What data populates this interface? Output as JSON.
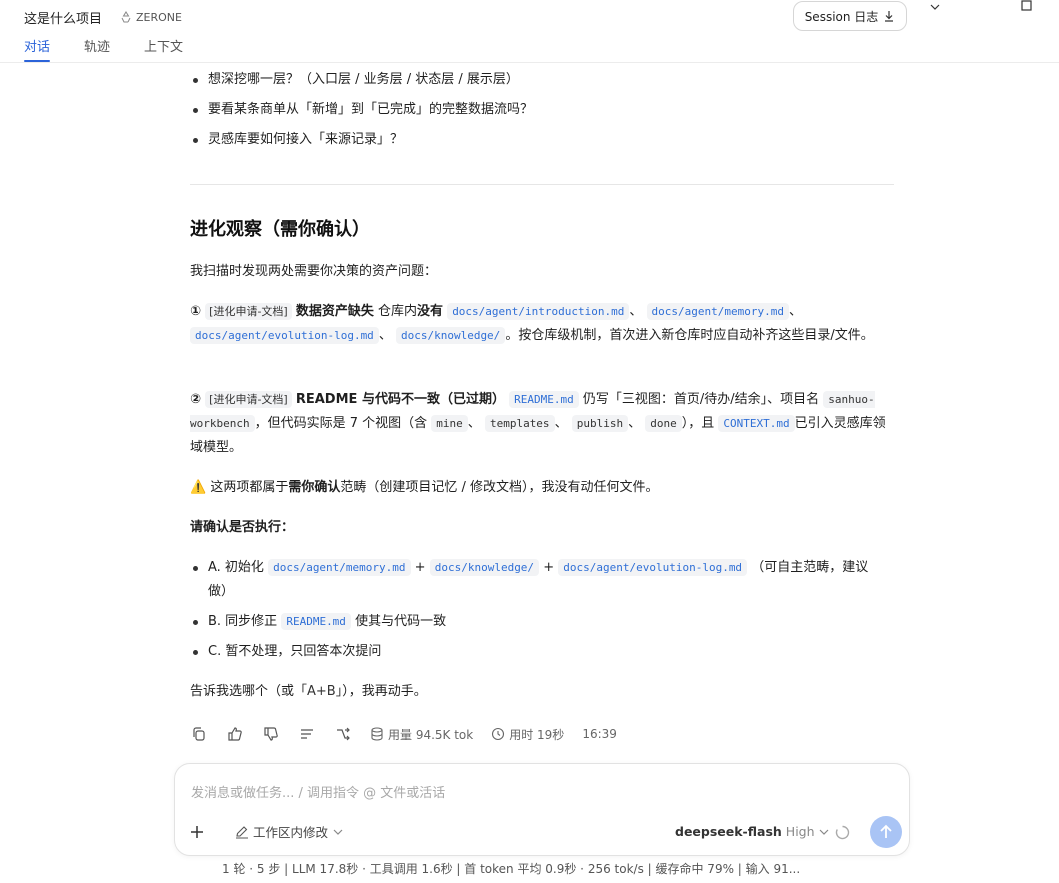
{
  "header": {
    "title": "这是什么项目",
    "brand": "ZERONE",
    "tabs": [
      "对话",
      "轨迹",
      "上下文"
    ],
    "session_button": "Session 日志"
  },
  "bullets_top": [
    "想深挖哪一层？（入口层 / 业务层 / 状态层 / 展示层）",
    "要看某条商单从「新增」到「已完成」的完整数据流吗？",
    "灵感库要如何接入「来源记录」？"
  ],
  "section": {
    "heading": "进化观察（需你确认）",
    "intro": "我扫描时发现两处需要你决策的资产问题：",
    "item1": {
      "num": "①",
      "tag": "[进化申请-文档]",
      "bold": "数据资产缺失",
      "t1": "仓库内",
      "bold2": "没有",
      "code1": "docs/agent/introduction.md",
      "sep1": "、",
      "code2": "docs/agent/memory.md",
      "sep2": "、",
      "code3": "docs/agent/evolution-log.md",
      "sep3": "、",
      "code4": "docs/knowledge/",
      "t2": "。按仓库级机制，首次进入新仓库时应自动补齐这些目录/文件。"
    },
    "item2": {
      "num": "②",
      "tag": "[进化申请-文档]",
      "bold": "README 与代码不一致（已过期）",
      "code1": "README.md",
      "t1": "仍写「三视图：首页/待办/结余」、项目名",
      "code2": "sanhuo-workbench",
      "t2": "，但代码实际是 7 个视图（含",
      "code3": "mine",
      "s1": "、",
      "code4": "templates",
      "s2": "、",
      "code5": "publish",
      "s3": "、",
      "code6": "done",
      "t3": "），且",
      "code7": "CONTEXT.md",
      "t4": "已引入灵感库领域模型。"
    },
    "warning": {
      "icon": "⚠️",
      "t1": "这两项都属于",
      "bold": "需你确认",
      "t2": "范畴（创建项目记忆 / 修改文档），我没有动任何文件。"
    },
    "confirm_heading": "请确认是否执行：",
    "options": {
      "a": {
        "t1": "A. 初始化",
        "code1": "docs/agent/memory.md",
        "plus1": "+",
        "code2": "docs/knowledge/",
        "plus2": "+",
        "code3": "docs/agent/evolution-log.md",
        "t2": "（可自主范畴，建议做）"
      },
      "b": {
        "t1": "B. 同步修正",
        "code1": "README.md",
        "t2": "使其与代码一致"
      },
      "c": {
        "t1": "C. 暂不处理，只回答本次提问"
      }
    },
    "closing": {
      "t1": "告诉我选哪个（或",
      "t2": "「A+B」",
      "t3": "），我再动手。"
    }
  },
  "actions": {
    "usage_label": "用量 94.5K tok",
    "time_label": "用时 19秒",
    "clock": "16:39"
  },
  "composer": {
    "placeholder": "发消息或做任务... / 调用指令 @ 文件或活话",
    "workspace": "工作区内修改",
    "model_name": "deepseek-flash",
    "model_level": "High"
  },
  "statusbar": "1 轮 · 5 步  |  LLM 17.8秒 · 工具调用 1.6秒  |  首 token 平均 0.9秒 · 256 tok/s  |  缓存命中 79%  |  输入 91...",
  "colors": {
    "accent": "#2b63d9",
    "send": "#a9c4f5"
  }
}
